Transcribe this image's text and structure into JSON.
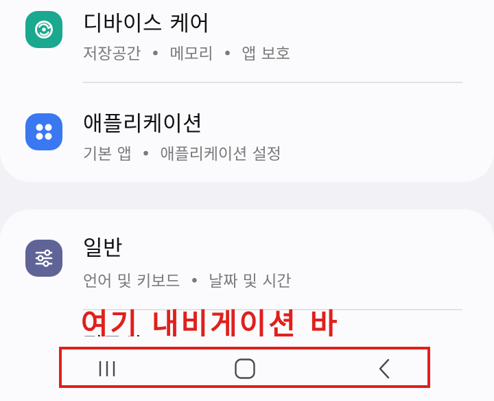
{
  "settings": {
    "items": [
      {
        "title": "디바이스 케어",
        "subtitle_parts": [
          "저장공간",
          "메모리",
          "앱 보호"
        ],
        "icon": "device-care-icon",
        "icon_color": "#1aa88f"
      },
      {
        "title": "애플리케이션",
        "subtitle_parts": [
          "기본 앱",
          "애플리케이션 설정"
        ],
        "icon": "apps-icon",
        "icon_color": "#3a78f2"
      },
      {
        "title": "일반",
        "subtitle_parts": [
          "언어 및 키보드",
          "날짜 및 시간"
        ],
        "icon": "sliders-icon",
        "icon_color": "#5f6396"
      }
    ],
    "separator": "•",
    "partial_next_title": "접근성"
  },
  "annotation": {
    "text": "여기 내비게이션 바",
    "color": "#e0201c"
  },
  "navbar": {
    "buttons": [
      {
        "name": "recent-apps-button",
        "icon": "recent-apps-icon"
      },
      {
        "name": "home-button",
        "icon": "home-icon"
      },
      {
        "name": "back-button",
        "icon": "back-icon"
      }
    ]
  },
  "colors": {
    "background": "#f2f2f6",
    "card": "#fbfbfe",
    "highlight": "#e0201c"
  }
}
